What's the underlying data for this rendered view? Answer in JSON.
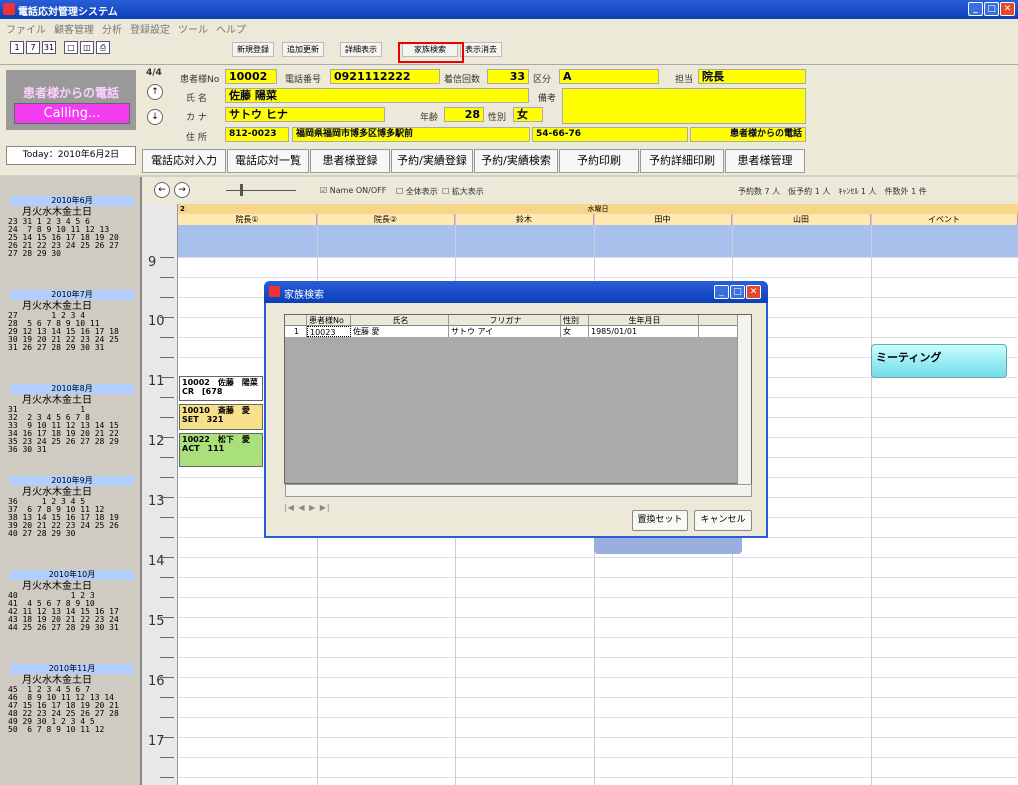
{
  "window": {
    "title": "電話応対管理システム"
  },
  "menu": [
    "ファイル",
    "顧客管理",
    "分析",
    "登録設定",
    "ツール",
    "ヘルプ"
  ],
  "toolbar": {
    "tab_new": "新規登録",
    "tab_add": "追加更新",
    "tab_detail": "詳細表示",
    "tab_family": "家族検索",
    "tab_clear": "表示消去"
  },
  "brand": {
    "text": "患者様からの電話",
    "calling": "Calling...",
    "today": "Today：2010年6月2日"
  },
  "patient": {
    "counter": "4/4",
    "no_label": "患者様No",
    "no": "10002",
    "phone_label": "電話番号",
    "phone": "0921112222",
    "calls_label": "着信回数",
    "calls": "33",
    "kubun_label": "区分",
    "kubun": "A",
    "tanto_label": "担当",
    "tanto": "院長",
    "name_label": "氏 名",
    "name": "佐藤 陽菜",
    "biko_label": "備考",
    "kana_label": "カ ナ",
    "kana": "サトウ ヒナ",
    "age_label": "年齢",
    "age": "28",
    "sex_label": "性別",
    "sex": "女",
    "addr_label": "住 所",
    "zip": "812-0023",
    "address": "福岡県福岡市博多区博多駅前",
    "addr2": "54-66-76",
    "call_tag": "患者様からの電話"
  },
  "nav": [
    "電話応対入力",
    "電話応対一覧",
    "患者様登録",
    "予約/実績登録",
    "予約/実績検索",
    "予約印刷",
    "予約詳細印刷",
    "患者様管理"
  ],
  "sched": {
    "name_onoff": "Name ON/OFF",
    "all_show": "全体表示",
    "zoom_show": "拡大表示",
    "summary": "予約数 7 人　仮予約 1 人　ｷｬﾝｾﾙ 1 人　件数外 1 件",
    "day_no": "2",
    "weekday": "水曜日",
    "columns": [
      "院長①",
      "院長②",
      "鈴木",
      "田中",
      "山田",
      "イベント"
    ],
    "hours": [
      "9",
      "10",
      "11",
      "12",
      "13",
      "14",
      "15",
      "16",
      "17"
    ],
    "meeting": "ミーティング"
  },
  "appts": [
    {
      "line1": "10002　佐藤　陽菜",
      "line2": "CR　[678"
    },
    {
      "line1": "10010　斎藤　愛",
      "line2": "SET　321"
    },
    {
      "line1": "10022　松下　愛",
      "line2": "ACT　111"
    }
  ],
  "calendar": [
    {
      "title": "2010年6月",
      "dow": "月火水木金土日",
      "rows": [
        "23 31 1 2 3 4 5 6",
        "24  7 8 9 10 11 12 13",
        "25 14 15 16 17 18 19 20",
        "26 21 22 23 24 25 26 27",
        "27 28 29 30"
      ]
    },
    {
      "title": "2010年7月",
      "dow": "月火水木金土日",
      "rows": [
        "27       1 2 3 4",
        "28  5 6 7 8 9 10 11",
        "29 12 13 14 15 16 17 18",
        "30 19 20 21 22 23 24 25",
        "31 26 27 28 29 30 31"
      ]
    },
    {
      "title": "2010年8月",
      "dow": "月火水木金土日",
      "rows": [
        "31             1",
        "32  2 3 4 5 6 7 8",
        "33  9 10 11 12 13 14 15",
        "34 16 17 18 19 20 21 22",
        "35 23 24 25 26 27 28 29",
        "36 30 31"
      ]
    },
    {
      "title": "2010年9月",
      "dow": "月火水木金土日",
      "rows": [
        "36     1 2 3 4 5",
        "37  6 7 8 9 10 11 12",
        "38 13 14 15 16 17 18 19",
        "39 20 21 22 23 24 25 26",
        "40 27 28 29 30"
      ]
    },
    {
      "title": "2010年10月",
      "dow": "月火水木金土日",
      "rows": [
        "40           1 2 3",
        "41  4 5 6 7 8 9 10",
        "42 11 12 13 14 15 16 17",
        "43 18 19 20 21 22 23 24",
        "44 25 26 27 28 29 30 31"
      ]
    },
    {
      "title": "2010年11月",
      "dow": "月火水木金土日",
      "rows": [
        "45  1 2 3 4 5 6 7",
        "46  8 9 10 11 12 13 14",
        "47 15 16 17 18 19 20 21",
        "48 22 23 24 25 26 27 28",
        "49 29 30 1 2 3 4 5",
        "50  6 7 8 9 10 11 12"
      ]
    }
  ],
  "dialog": {
    "title": "家族検索",
    "headers": [
      "患者様No",
      "氏名",
      "フリガナ",
      "性別",
      "生年月日"
    ],
    "row": {
      "idx": "1",
      "no": "10023",
      "name": "佐藤 愛",
      "kana": "サトウ アイ",
      "sex": "女",
      "birth": "1985/01/01"
    },
    "pager": "|◀ ◀ ▶ ▶|",
    "btn_set": "置換セット",
    "btn_cancel": "キャンセル"
  }
}
